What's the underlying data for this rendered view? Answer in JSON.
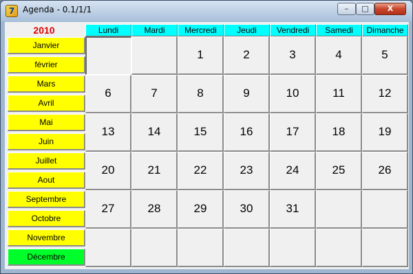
{
  "window": {
    "title": "Agenda - 0.1/1/1"
  },
  "window_buttons": {
    "minimize": "–",
    "maximize": "□",
    "close": "X"
  },
  "year": "2010",
  "months": [
    "Janvier",
    "février",
    "Mars",
    "Avril",
    "Mai",
    "Juin",
    "Juillet",
    "Aout",
    "Septembre",
    "Octobre",
    "Novembre",
    "Décembre"
  ],
  "active_month_index": 11,
  "weekdays": [
    "Lundi",
    "Mardi",
    "Mercredi",
    "Jeudi",
    "Vendredi",
    "Samedi",
    "Dimanche"
  ],
  "calendar_rows": [
    [
      "",
      "",
      "1",
      "2",
      "3",
      "4",
      "5"
    ],
    [
      "6",
      "7",
      "8",
      "9",
      "10",
      "11",
      "12"
    ],
    [
      "13",
      "14",
      "15",
      "16",
      "17",
      "18",
      "19"
    ],
    [
      "20",
      "21",
      "22",
      "23",
      "24",
      "25",
      "26"
    ],
    [
      "27",
      "28",
      "29",
      "30",
      "31",
      "",
      ""
    ],
    [
      "",
      "",
      "",
      "",
      "",
      "",
      ""
    ]
  ],
  "colors": {
    "year": "#e00000",
    "month_button": "#ffff00",
    "active_month": "#00ff2a",
    "weekday_header": "#00ffff"
  }
}
